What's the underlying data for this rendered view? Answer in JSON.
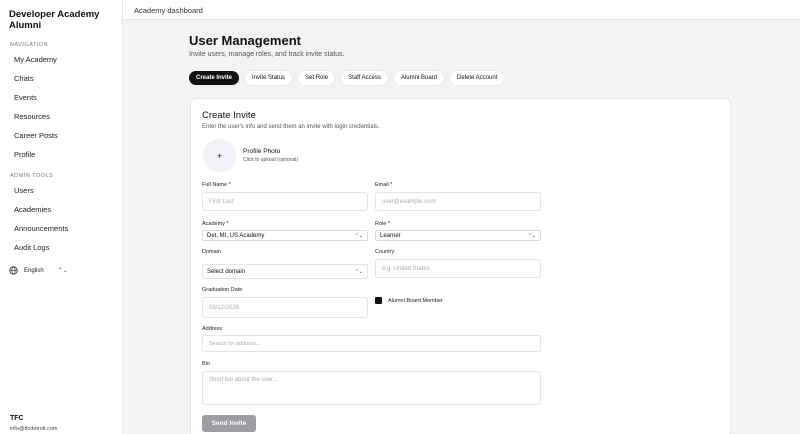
{
  "sidebar": {
    "brand": "Developer Academy Alumni",
    "nav_label": "NAVIGATION",
    "nav_items": [
      "My Academy",
      "Chats",
      "Events",
      "Resources",
      "Career Posts",
      "Profile"
    ],
    "admin_label": "ADMIN TOOLS",
    "admin_items": [
      "Users",
      "Academies",
      "Announcements",
      "Audit Logs"
    ],
    "language": "English",
    "user_name": "TFC",
    "user_email": "info@tfcdetroit.com"
  },
  "topbar": {
    "title": "Academy dashboard"
  },
  "page": {
    "title": "User Management",
    "subtitle": "Invite users, manage roles, and track invite status."
  },
  "tabs": [
    "Create Invite",
    "Invite Status",
    "Set Role",
    "Staff Access",
    "Alumni Board",
    "Delete Account"
  ],
  "form": {
    "title": "Create Invite",
    "subtitle": "Enter the user's info and send them an invite with login credentials.",
    "photo_title": "Profile Photo",
    "photo_hint": "Click to upload (optional)",
    "photo_plus": "+",
    "full_name_label": "Full Name *",
    "full_name_placeholder": "First Last",
    "email_label": "Email *",
    "email_placeholder": "user@example.com",
    "academy_label": "Academy *",
    "academy_value": "Det, MI, US Academy",
    "role_label": "Role *",
    "role_value": "Learner",
    "domain_label": "Domain",
    "domain_value": "Select domain",
    "country_label": "Country",
    "country_placeholder": "e.g. United States",
    "grad_label": "Graduation Date",
    "grad_placeholder": "03/12/2026",
    "alumni_board_label": "Alumni Board Member",
    "address_label": "Address",
    "address_placeholder": "Search for address...",
    "bio_label": "Bio",
    "bio_placeholder": "Short bio about the user...",
    "send_label": "Send Invite"
  },
  "colors": {
    "accent": "#111111",
    "disabled_button": "#9c9ca3",
    "background": "#f3f3f6"
  }
}
